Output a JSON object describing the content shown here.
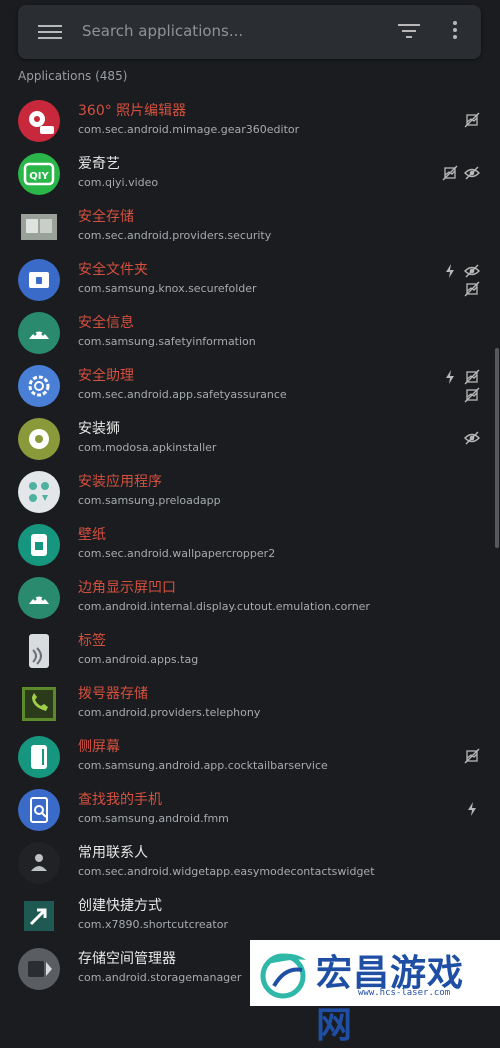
{
  "search": {
    "placeholder": "Search applications..."
  },
  "list_header": "Applications (485)",
  "apps": [
    {
      "name": "360° 照片编辑器",
      "package": "com.sec.android.mimage.gear360editor",
      "name_color": "red",
      "flags": [
        "no-trackers-icon"
      ]
    },
    {
      "name": "爱奇艺",
      "package": "com.qiyi.video",
      "name_color": "white",
      "flags": [
        "hidden-icon",
        "no-trackers-icon"
      ]
    },
    {
      "name": "安全存储",
      "package": "com.sec.android.providers.security",
      "name_color": "red",
      "flags": []
    },
    {
      "name": "安全文件夹",
      "package": "com.samsung.knox.securefolder",
      "name_color": "red",
      "flags": [
        "bolt-icon",
        "hidden-icon",
        "no-trackers-icon"
      ]
    },
    {
      "name": "安全信息",
      "package": "com.samsung.safetyinformation",
      "name_color": "red",
      "flags": []
    },
    {
      "name": "安全助理",
      "package": "com.sec.android.app.safetyassurance",
      "name_color": "red",
      "flags": [
        "bolt-icon",
        "no-trackers-icon",
        "no-trackers-icon"
      ]
    },
    {
      "name": "安装狮",
      "package": "com.modosa.apkinstaller",
      "name_color": "white",
      "flags": [
        "hidden-icon"
      ]
    },
    {
      "name": "安装应用程序",
      "package": "com.samsung.preloadapp",
      "name_color": "red",
      "flags": []
    },
    {
      "name": "壁纸",
      "package": "com.sec.android.wallpapercropper2",
      "name_color": "red",
      "flags": []
    },
    {
      "name": "边角显示屏凹口",
      "package": "com.android.internal.display.cutout.emulation.corner",
      "name_color": "red",
      "flags": []
    },
    {
      "name": "标签",
      "package": "com.android.apps.tag",
      "name_color": "red",
      "flags": []
    },
    {
      "name": "拨号器存储",
      "package": "com.android.providers.telephony",
      "name_color": "red",
      "flags": []
    },
    {
      "name": "侧屏幕",
      "package": "com.samsung.android.app.cocktailbarservice",
      "name_color": "red",
      "flags": [
        "no-trackers-icon"
      ]
    },
    {
      "name": "查找我的手机",
      "package": "com.samsung.android.fmm",
      "name_color": "red",
      "flags": [
        "bolt-icon"
      ]
    },
    {
      "name": "常用联系人",
      "package": "com.sec.android.widgetapp.easymodecontactswidget",
      "name_color": "white",
      "flags": []
    },
    {
      "name": "创建快捷方式",
      "package": "com.x7890.shortcutcreator",
      "name_color": "white",
      "flags": []
    },
    {
      "name": "存储空间管理器",
      "package": "com.android.storagemanager",
      "name_color": "white",
      "flags": []
    }
  ],
  "watermark": {
    "title": "宏昌游戏网",
    "url": "www.hcs-laser.com"
  },
  "colors": {
    "background": "#1a1c1f",
    "disabled_name": "#d4503f",
    "enabled_name": "#e8e8e8",
    "watermark_blue": "#1f4fa5"
  }
}
